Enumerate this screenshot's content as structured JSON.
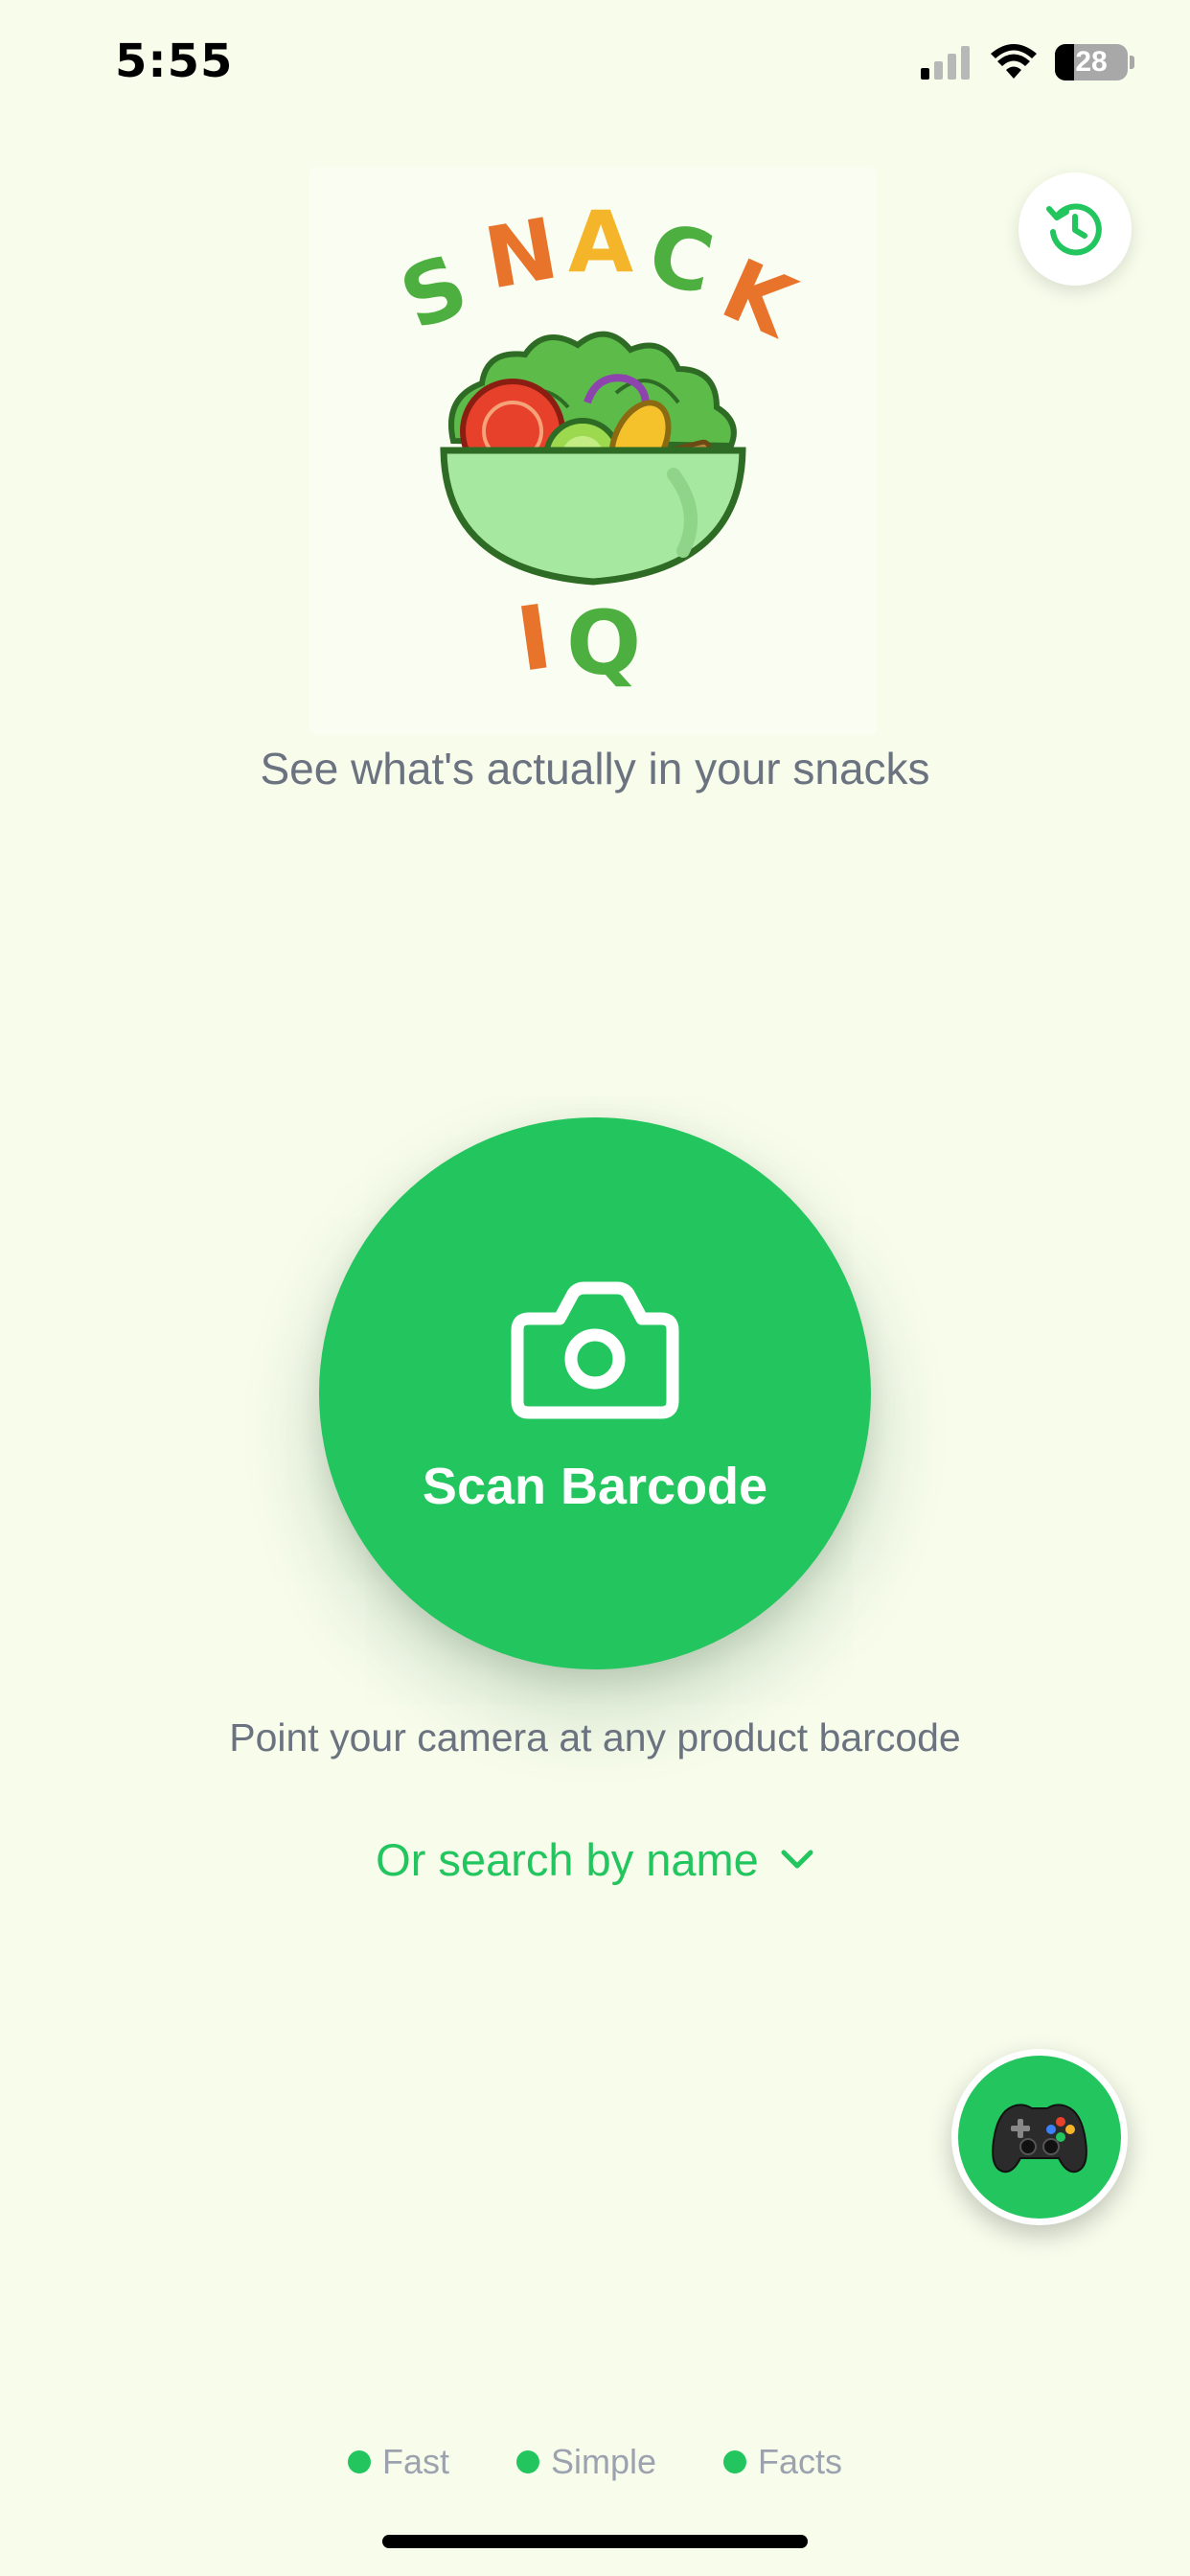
{
  "status_bar": {
    "time": "5:55",
    "battery": "28"
  },
  "header": {
    "history_icon": "history-clock-icon"
  },
  "logo": {
    "top_text": "SNACK",
    "bottom_text": "IQ"
  },
  "tagline": "See what's actually in your snacks",
  "scan": {
    "label": "Scan Barcode",
    "icon": "camera-icon",
    "hint": "Point your camera at any product barcode"
  },
  "search": {
    "label": "Or search by name",
    "icon": "chevron-down-icon"
  },
  "game_button": {
    "icon": "game-controller-icon"
  },
  "features": [
    {
      "label": "Fast"
    },
    {
      "label": "Simple"
    },
    {
      "label": "Facts"
    }
  ],
  "colors": {
    "accent": "#22C55E",
    "background": "#F7FCEB",
    "muted_text": "#6B7280"
  }
}
